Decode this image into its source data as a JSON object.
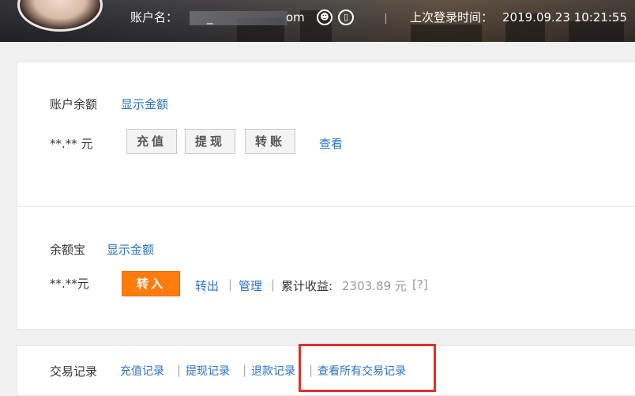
{
  "header": {
    "account_label": "账户名：",
    "account_visible_suffix": "om",
    "account_prefix_char": "_",
    "icons": [
      "user-circle-icon",
      "phone-icon"
    ],
    "last_login_label": "上次登录时间：",
    "last_login_value": "2019.09.23 10:21:55"
  },
  "balance_panel": {
    "title": "账户余额",
    "show_link": "显示金额",
    "amount": "**.** 元",
    "buttons": {
      "recharge": "充值",
      "withdraw": "提现",
      "transfer": "转账"
    },
    "view_link": "查看"
  },
  "yuebao_panel": {
    "title": "余额宝",
    "show_link": "显示金额",
    "amount": "**.**元",
    "transfer_in": "转入",
    "transfer_out": "转出",
    "manage": "管理",
    "earnings_label": "累计收益:",
    "earnings_value": "2303.89 元",
    "help": "[?]"
  },
  "trade_panel": {
    "title": "交易记录",
    "links": {
      "recharge_records": "充值记录",
      "withdraw_records": "提现记录",
      "refund_records": "退款记录",
      "all_records": "查看所有交易记录"
    }
  },
  "colors": {
    "link": "#2b72c8",
    "accent_orange": "#ff7b0e",
    "highlight_red": "#e0312c"
  }
}
